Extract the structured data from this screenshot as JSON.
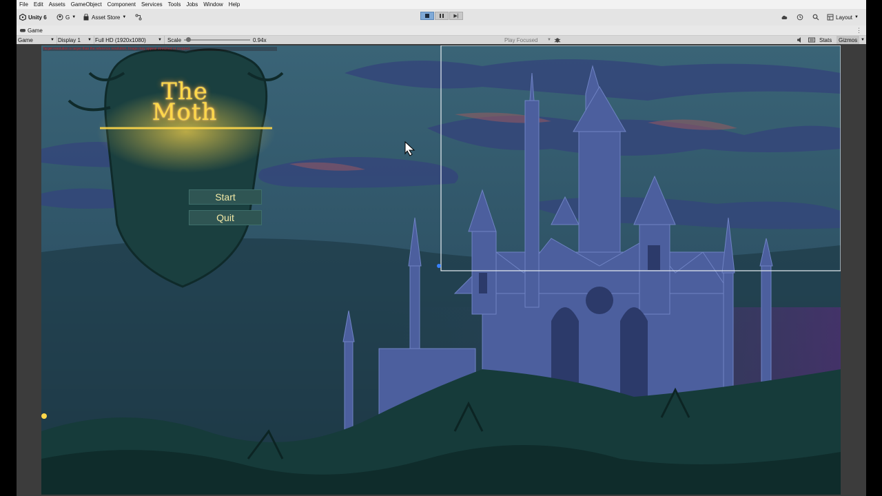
{
  "menu": [
    "File",
    "Edit",
    "Assets",
    "GameObject",
    "Component",
    "Services",
    "Tools",
    "Jobs",
    "Window",
    "Help"
  ],
  "toolbar": {
    "unity_label": "Unity 6",
    "account_label": "G",
    "asset_store_label": "Asset Store",
    "layout_label": "Layout"
  },
  "tab": {
    "label": "Game"
  },
  "game_toolbar": {
    "view_mode": "Game",
    "display": "Display 1",
    "resolution": "Full HD (1920x1080)",
    "scale_label": "Scale",
    "scale_value": "0.94x",
    "scale_fraction": 0.03,
    "play_focused": "Play Focused",
    "stats_label": "Stats",
    "gizmos_label": "Gizmos"
  },
  "warning": "Target resolution is larger than the reference resolution. Image may appear stretched or cropped.",
  "game": {
    "title_line1": "The",
    "title_line2": "Moth",
    "start_label": "Start",
    "quit_label": "Quit"
  },
  "colors": {
    "sky": "#3b6678",
    "sky_dark": "#1f3b49",
    "castle": "#4b5f9c",
    "glow": "#ffd84a",
    "foliage": "#1a4140"
  }
}
